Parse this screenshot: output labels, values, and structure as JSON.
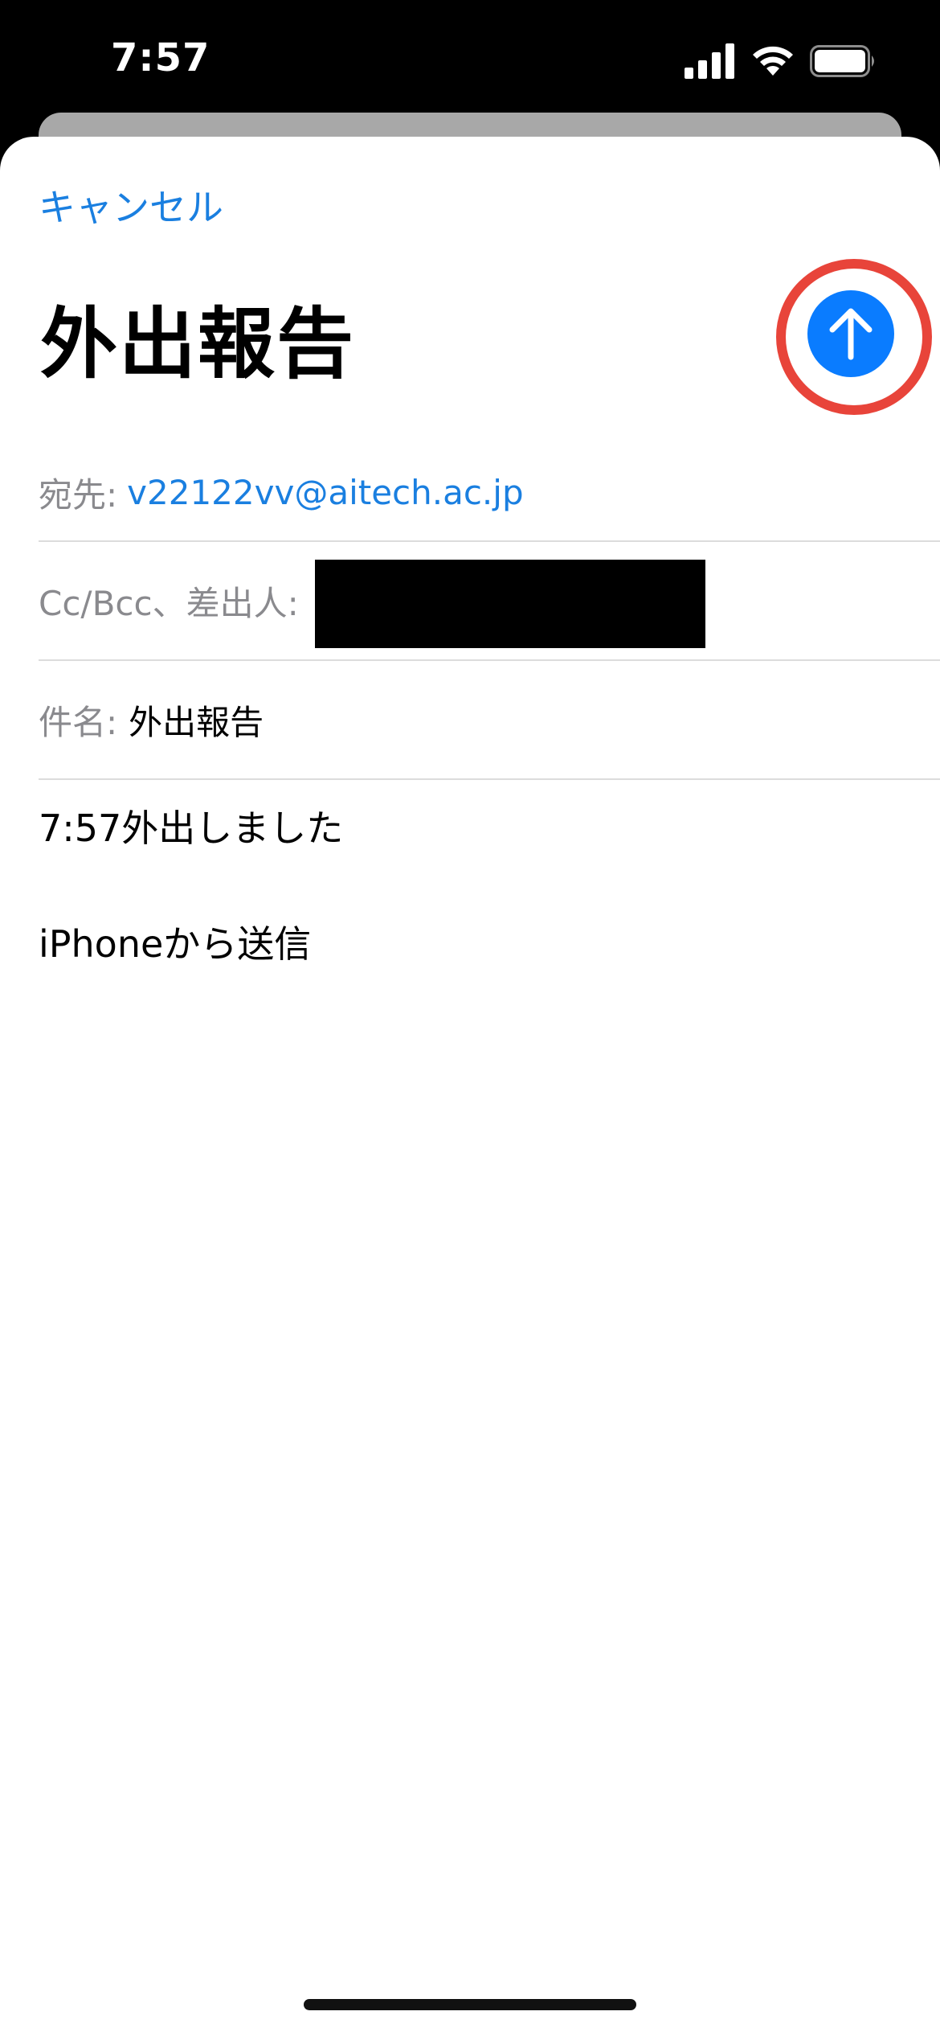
{
  "status_bar": {
    "time": "7:57"
  },
  "compose": {
    "cancel_label": "キャンセル",
    "title": "外出報告",
    "send_icon": "arrow-up-icon",
    "to_label": "宛先:",
    "to_value": "v22122vv@aitech.ac.jp",
    "cc_label": "Cc/Bcc、差出人:",
    "subject_label": "件名:",
    "subject_value": "外出報告",
    "body_line_1": "7:57外出しました",
    "body_line_2": "iPhoneから送信"
  },
  "colors": {
    "accent": "#1a7fe0",
    "send_button": "#0a7cff",
    "highlight_ring": "#e8443a",
    "label_gray": "#8a8a8e"
  }
}
